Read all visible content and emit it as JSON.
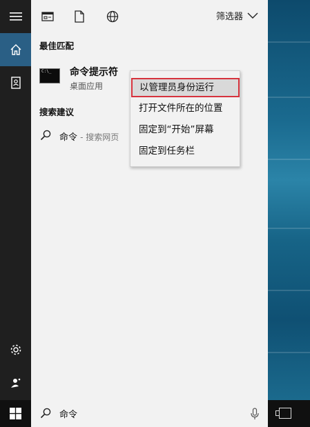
{
  "topbar": {
    "filter_label": "筛选器",
    "icons": [
      "documents-icon",
      "file-icon",
      "globe-icon"
    ]
  },
  "best_match": {
    "section_title": "最佳匹配",
    "app_name": "命令提示符",
    "app_subtitle": "桌面应用"
  },
  "suggestions": {
    "section_title": "搜索建议",
    "items": [
      {
        "term": "命令",
        "suffix": "- 搜索网页"
      }
    ]
  },
  "context_menu": {
    "items": [
      {
        "label": "以管理员身份运行",
        "highlighted": true
      },
      {
        "label": "打开文件所在的位置",
        "highlighted": false
      },
      {
        "label": "固定到“开始”屏幕",
        "highlighted": false
      },
      {
        "label": "固定到任务栏",
        "highlighted": false
      }
    ]
  },
  "search": {
    "value": "命令"
  },
  "colors": {
    "rail_bg": "#1f1f1f",
    "rail_active": "#2a5f85",
    "panel_bg": "#f2f2f2",
    "highlight_border": "#d6323c"
  }
}
